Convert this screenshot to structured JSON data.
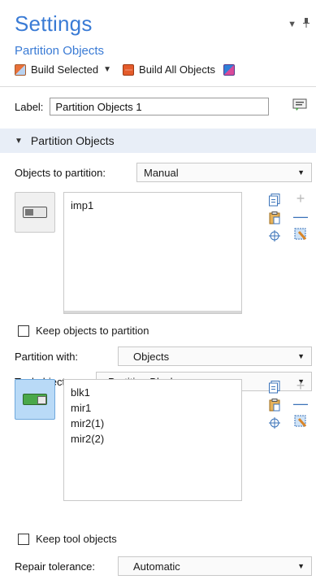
{
  "header": {
    "title": "Settings",
    "subtitle": "Partition Objects"
  },
  "toolbar": {
    "build_selected": "Build Selected",
    "build_all": "Build All Objects"
  },
  "label_row": {
    "label": "Label:",
    "value": "Partition Objects 1"
  },
  "section": {
    "title": "Partition Objects"
  },
  "objects": {
    "label": "Objects to partition:",
    "mode": "Manual",
    "items": [
      "imp1"
    ],
    "keep_label": "Keep objects to partition",
    "keep_checked": false
  },
  "partition_with": {
    "label": "Partition with:",
    "value": "Objects"
  },
  "tool_objects": {
    "label": "Tool objects:",
    "value": "Partition Block",
    "items": [
      "blk1",
      "mir1",
      "mir2(1)",
      "mir2(2)"
    ],
    "keep_label": "Keep tool objects",
    "keep_checked": false
  },
  "repair": {
    "label": "Repair tolerance:",
    "value": "Automatic"
  },
  "colors": {
    "accent": "#3a7bd5",
    "section_bg": "#e8eef7",
    "active_toggle": "#b9daf7"
  }
}
